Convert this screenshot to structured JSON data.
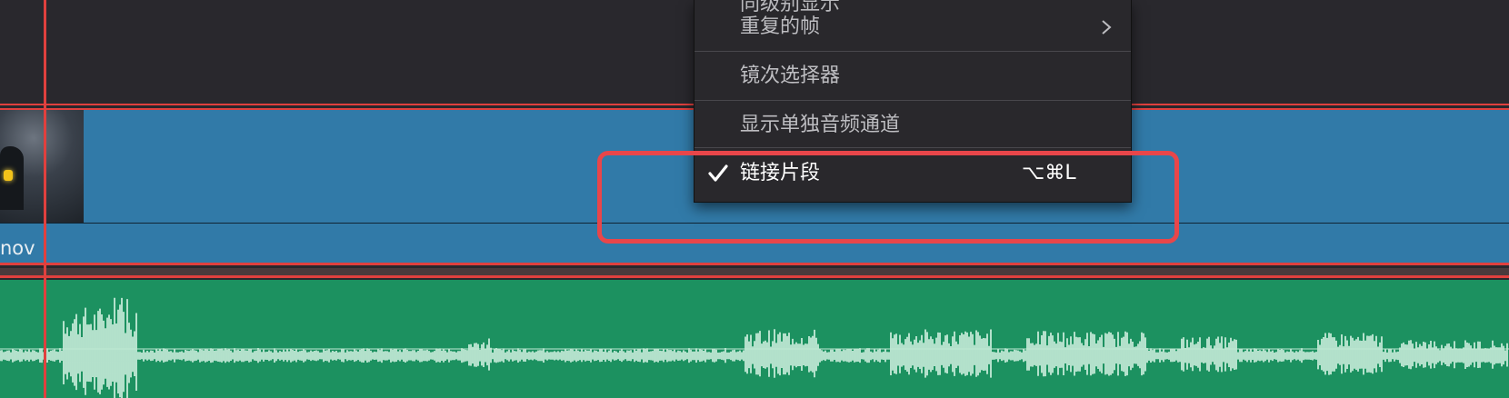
{
  "menu": {
    "partial_top_item": "同级别显示",
    "items": [
      {
        "label": "重复的帧",
        "has_submenu": true
      },
      {
        "label": "镜次选择器"
      },
      {
        "label": "显示单独音频通道"
      },
      {
        "label": "链接片段",
        "checked": true,
        "shortcut": "⌥⌘L"
      }
    ]
  },
  "timeline": {
    "video_clip_name": "nov"
  },
  "colors": {
    "video_clip": "#317aa8",
    "audio_clip": "#1c9160",
    "playhead": "#e0403e",
    "highlight": "#e8464a"
  },
  "icons": {
    "submenu": "chevron-right-icon",
    "checked": "checkmark-icon"
  }
}
